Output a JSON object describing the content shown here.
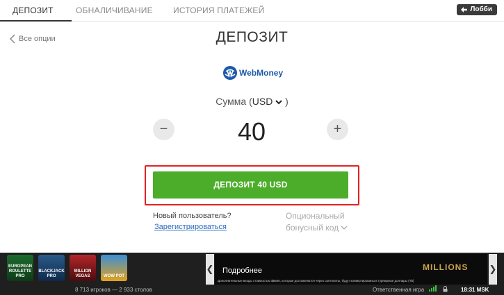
{
  "tabs": [
    {
      "label": "ДЕПОЗИТ",
      "active": true
    },
    {
      "label": "ОБНАЛИЧИВАНИЕ",
      "active": false
    },
    {
      "label": "ИСТОРИЯ ПЛАТЕЖЕЙ",
      "active": false
    }
  ],
  "lobby_label": "Лобби",
  "back_label": "Все опции",
  "page_title": "ДЕПОЗИТ",
  "payment_method": {
    "name": "WebMoney",
    "icon": "webmoney-globe-icon",
    "color": "#1e5aa8"
  },
  "amount": {
    "label_prefix": "Сумма (",
    "currency": "USD",
    "label_suffix": " )",
    "value": "40",
    "minus": "−",
    "plus": "+"
  },
  "deposit_button_label": "ДЕПОЗИТ 40 USD",
  "new_user_text": "Новый пользователь?",
  "register_link": "Зарегистрироваться",
  "promo": {
    "line1": "Опциональный",
    "line2": "бонусный код"
  },
  "games": [
    {
      "label": "EUROPEAN ROULETTE PRO",
      "icon": "european-roulette-thumb"
    },
    {
      "label": "BLACKJACK PRO",
      "icon": "blackjack-thumb"
    },
    {
      "label": "MILLION VEGAS",
      "icon": "million-vegas-thumb"
    },
    {
      "label": "WOW POT",
      "icon": "wow-pot-thumb"
    }
  ],
  "ad": {
    "title": "Подробнее",
    "description": "Дополнительные входы стоимостью $5500, которые доставляются через сателлиты, будут конвертированы в турнирные доллары (T$)",
    "logo": "MILLIONS"
  },
  "status": {
    "players": "8 713 игроков",
    "separator": "—",
    "tables": "2 933 столов",
    "responsible": "Ответственная игра",
    "time": "18:31 MSK"
  },
  "colors": {
    "accent_green": "#4cad2a",
    "highlight_red": "#e32222",
    "link_blue": "#2b6cc0"
  }
}
